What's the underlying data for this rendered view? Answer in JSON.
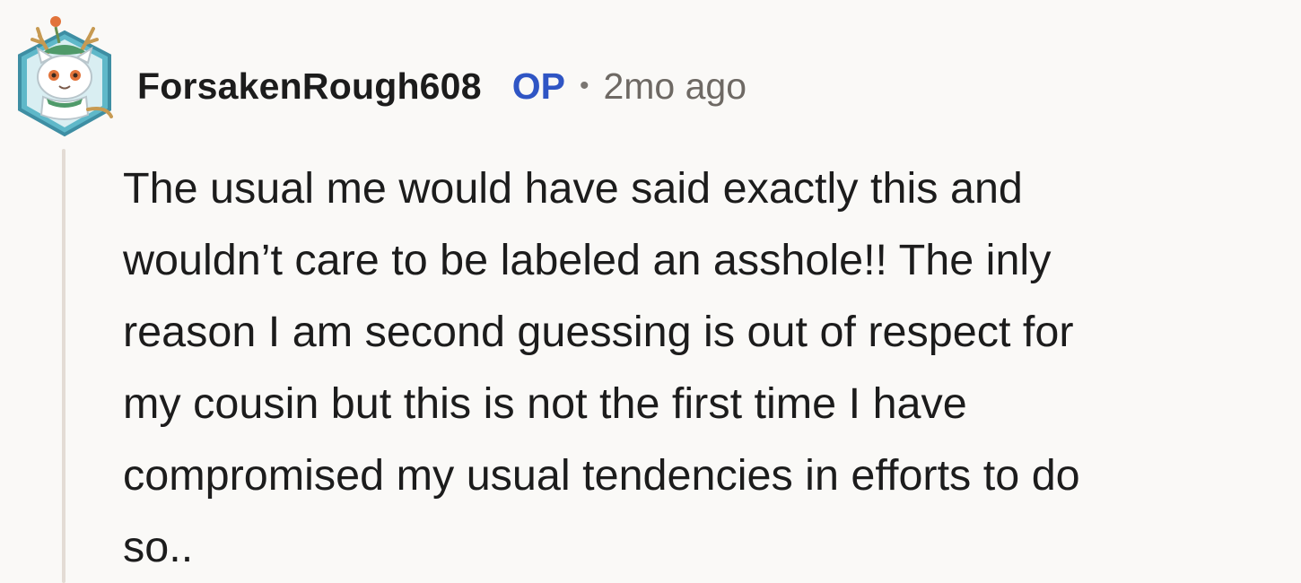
{
  "comment": {
    "username": "ForsakenRough608",
    "op_badge": "OP",
    "separator": "•",
    "timestamp": "2mo ago",
    "body": "The usual me would have said exactly this and\nwouldn’t care to be labeled an asshole!! The inly\nreason I am second guessing is out of respect for\nmy cousin but this is not the first time I have\ncompromised my usual tendencies in efforts to do\nso..",
    "avatar_icon": "snow-leopard-antler-avatar-icon"
  },
  "colors": {
    "background": "#faf9f7",
    "text": "#1c1c1c",
    "op_badge": "#2f55c4",
    "muted": "#6e6964",
    "thread_line": "#e3dcd5"
  }
}
